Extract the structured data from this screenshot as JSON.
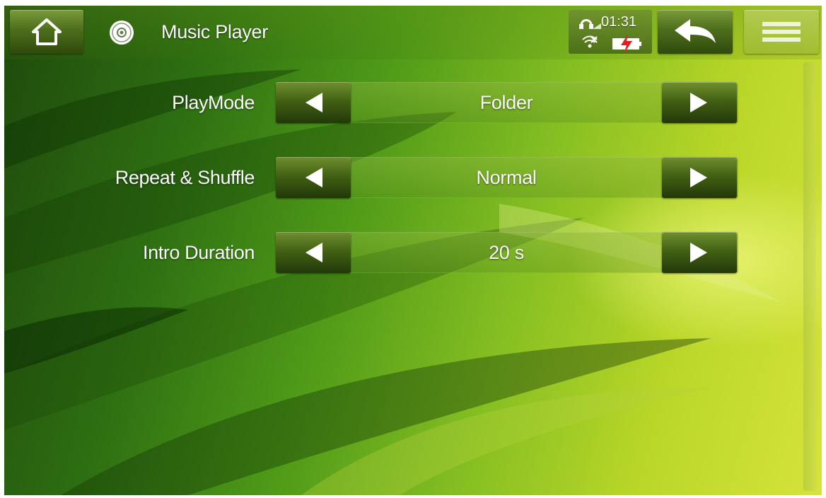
{
  "header": {
    "title": "Music Player",
    "home_icon": "home-icon",
    "app_icon": "music-disc-icon",
    "back_icon": "back-arrow-icon",
    "menu_icon": "menu-icon"
  },
  "status": {
    "time": "01:31",
    "icons": [
      "headphones-icon",
      "signal-bars-icon",
      "wifi-off-icon",
      "battery-charging-icon"
    ]
  },
  "settings": [
    {
      "label": "PlayMode",
      "value": "Folder"
    },
    {
      "label": "Repeat & Shuffle",
      "value": "Normal"
    },
    {
      "label": "Intro Duration",
      "value": "20 s"
    }
  ],
  "colors": {
    "accent_dark": "#2f4a0c",
    "accent_light": "#d6e33a",
    "text": "#ffffff"
  }
}
